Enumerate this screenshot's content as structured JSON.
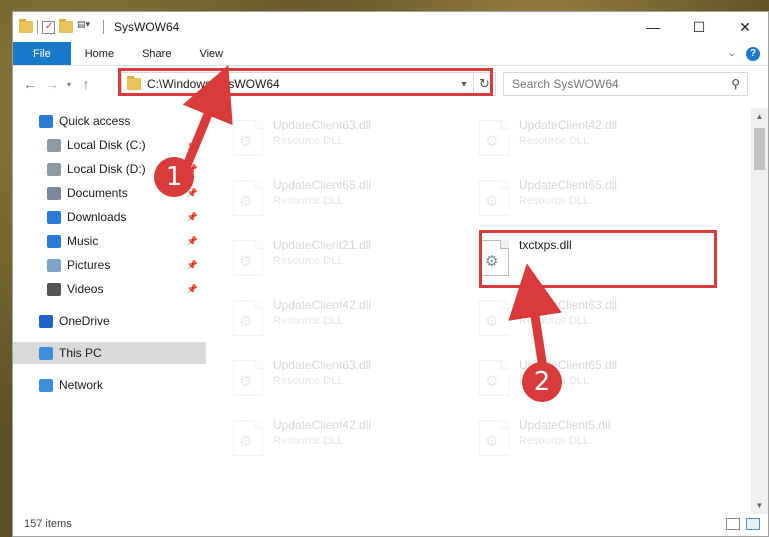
{
  "window": {
    "title": "SysWOW64"
  },
  "ribbon": {
    "tabs": [
      "File",
      "Home",
      "Share",
      "View"
    ],
    "help": "?"
  },
  "controls": {
    "minimize": "—",
    "maximize": "☐",
    "close": "✕"
  },
  "navbar": {
    "back": "←",
    "forward": "→",
    "up": "↑",
    "path": "C:\\Windows\\SysWOW64",
    "search_placeholder": "Search SysWOW64"
  },
  "sidebar": {
    "items": [
      {
        "label": "Quick access",
        "icon": "star-icon",
        "pinned": false
      },
      {
        "label": "Local Disk (C:)",
        "icon": "drive-icon",
        "pinned": true
      },
      {
        "label": "Local Disk (D:)",
        "icon": "drive-icon",
        "pinned": true
      },
      {
        "label": "Documents",
        "icon": "documents-icon",
        "pinned": true
      },
      {
        "label": "Downloads",
        "icon": "download-icon",
        "pinned": true
      },
      {
        "label": "Music",
        "icon": "music-icon",
        "pinned": true
      },
      {
        "label": "Pictures",
        "icon": "pictures-icon",
        "pinned": true
      },
      {
        "label": "Videos",
        "icon": "videos-icon",
        "pinned": true
      },
      {
        "label": "OneDrive",
        "icon": "cloud-icon",
        "pinned": false
      },
      {
        "label": "This PC",
        "icon": "computer-icon",
        "pinned": false,
        "selected": true
      },
      {
        "label": "Network",
        "icon": "network-icon",
        "pinned": false
      }
    ]
  },
  "files": [
    {
      "name": "UpdateClient63.dll",
      "type": "Resource DLL",
      "faded": true
    },
    {
      "name": "UpdateClient42.dll",
      "type": "Resource DLL",
      "faded": true
    },
    {
      "name": "UpdateClient65.dll",
      "type": "Resource DLL",
      "faded": true
    },
    {
      "name": "UpdateClient65.dll",
      "type": "Resource DLL",
      "faded": true
    },
    {
      "name": "UpdateClient21.dll",
      "type": "Resource DLL",
      "faded": true
    },
    {
      "name": "txctxps.dll",
      "type": "",
      "faded": false
    },
    {
      "name": "UpdateClient42.dll",
      "type": "Resource DLL",
      "faded": true
    },
    {
      "name": "UpdateClient63.dll",
      "type": "Resource DLL",
      "faded": true
    },
    {
      "name": "UpdateClient63.dll",
      "type": "Resource DLL",
      "faded": true
    },
    {
      "name": "UpdateClient65.dll",
      "type": "Resource DLL",
      "faded": true
    },
    {
      "name": "UpdateClient42.dll",
      "type": "Resource DLL",
      "faded": true
    },
    {
      "name": "UpdateClient5.dll",
      "type": "Resource DLL",
      "faded": true
    }
  ],
  "status": {
    "count": "157 items"
  },
  "annotations": {
    "step1": "1",
    "step2": "2"
  },
  "colors": {
    "accent": "#1979ca",
    "highlight": "#d93a3a"
  }
}
